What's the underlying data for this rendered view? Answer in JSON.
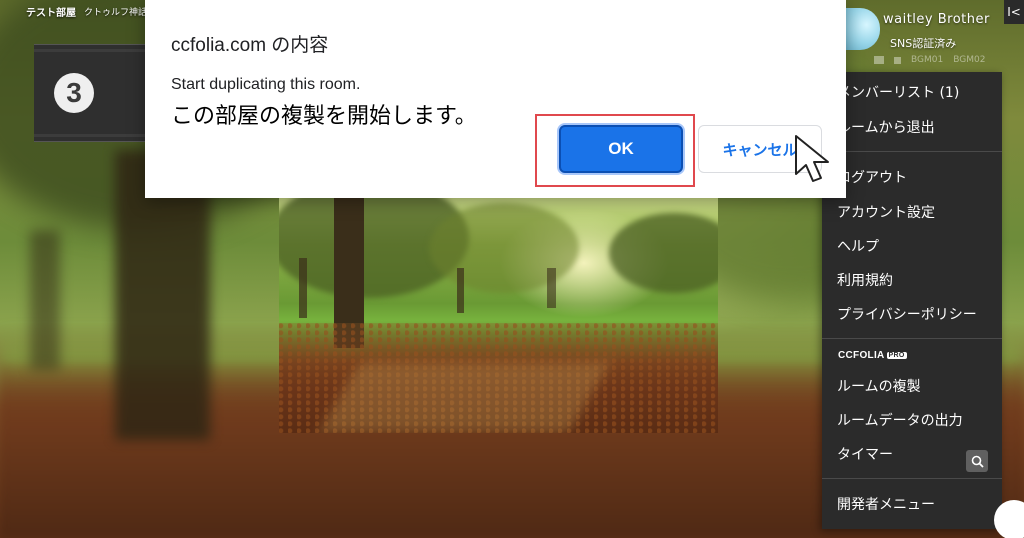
{
  "room": {
    "name": "テスト部屋",
    "scenario": "クトゥルフ神話"
  },
  "round": {
    "number": "3"
  },
  "dialog": {
    "title": "ccfolia.com の内容",
    "message_en": "Start duplicating this room.",
    "message_ja": "この部屋の複製を開始します。",
    "ok_label": "OK",
    "cancel_label": "キャンセル"
  },
  "user": {
    "name": "waitley Brother",
    "status": "SNS認証済み"
  },
  "panel": {
    "collapse_icon": "I<",
    "bgm_labels": [
      "BGM01",
      "BGM02"
    ]
  },
  "menu": {
    "group1": [
      "メンバーリスト (1)",
      "ルームから退出"
    ],
    "group2": [
      "ログアウト",
      "アカウント設定",
      "ヘルプ",
      "利用規約",
      "プライバシーポリシー"
    ],
    "pro_label": "CCFOLIA",
    "pro_badge": "PRO",
    "group3": [
      "ルームの複製",
      "ルームデータの出力",
      "タイマー"
    ],
    "group4": [
      "開発者メニュー"
    ]
  },
  "colors": {
    "ok_button": "#1a73e8",
    "highlight_box": "#e0484d",
    "menu_bg": "#2b2b2b"
  }
}
